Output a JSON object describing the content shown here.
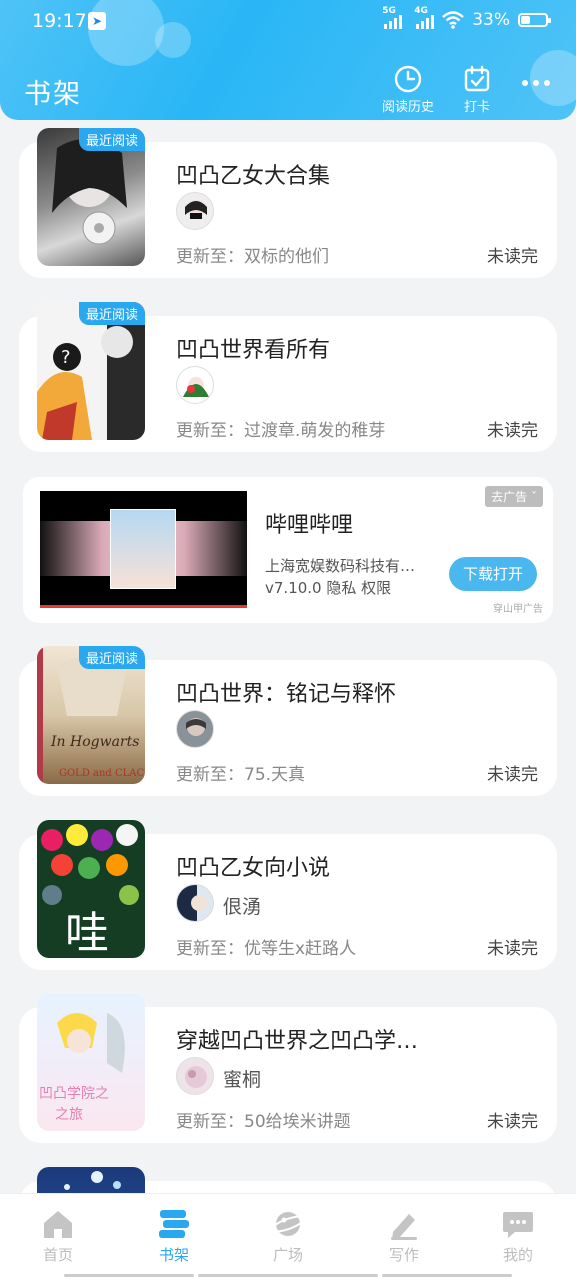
{
  "status_bar": {
    "time": "19:17",
    "signal1": "5G",
    "signal2": "4G",
    "battery": "33%"
  },
  "header": {
    "title": "书架",
    "history_label": "阅读历史",
    "checkin_label": "打卡"
  },
  "books": [
    {
      "title": "凹凸乙女大合集",
      "badge": "最近阅读",
      "author": "",
      "update": "更新至：双标的他们",
      "status": "未读完"
    },
    {
      "title": "凹凸世界看所有",
      "badge": "最近阅读",
      "author": "",
      "update": "更新至：过渡章.萌发的稚芽",
      "status": "未读完"
    },
    {
      "title": "凹凸世界：铭记与释怀",
      "badge": "最近阅读",
      "author": "",
      "update": "更新至：75.天真",
      "status": "未读完"
    },
    {
      "title": "凹凸乙女向小说",
      "badge": "",
      "author": "佷湧",
      "update": "更新至：优等生x赶路人",
      "status": "未读完"
    },
    {
      "title": "穿越凹凸世界之凹凸学…",
      "badge": "",
      "author": "蜜桐",
      "update": "更新至：50给埃米讲题",
      "status": "未读完"
    }
  ],
  "ad": {
    "title": "哔哩哔哩",
    "company": "上海宽娱数码科技有…",
    "meta": "v7.10.0  隐私  权限",
    "remove": "去广告 ˇ",
    "download": "下载打开",
    "source": "穿山甲广告"
  },
  "nav": [
    {
      "label": "首页"
    },
    {
      "label": "书架"
    },
    {
      "label": "广场"
    },
    {
      "label": "写作"
    },
    {
      "label": "我的"
    }
  ],
  "colors": {
    "accent": "#29a8f0",
    "header": "#4fc3f7",
    "inactive": "#bdbdbd"
  }
}
